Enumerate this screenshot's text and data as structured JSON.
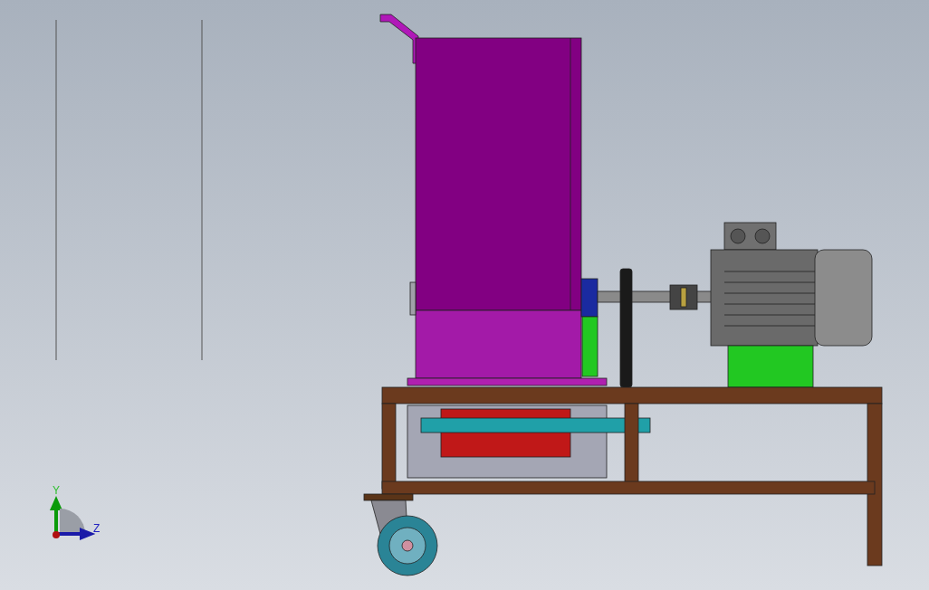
{
  "viewport": {
    "triad": {
      "axes": [
        {
          "label": "Y",
          "kind": "vertical"
        },
        {
          "label": "Z",
          "kind": "horizontal"
        }
      ]
    }
  }
}
